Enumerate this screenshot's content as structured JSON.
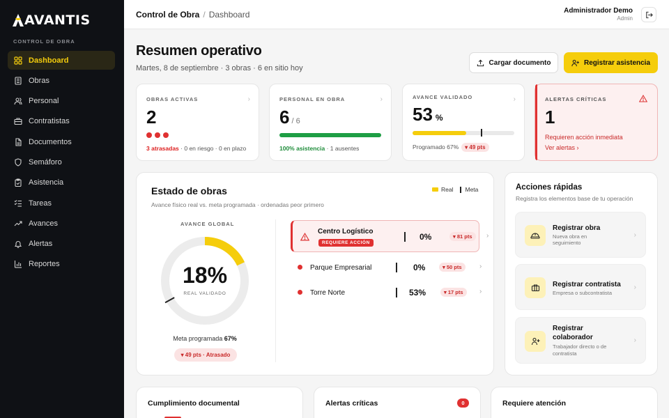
{
  "brand": {
    "name": "AVANTIS",
    "accent": "#f5cd0c"
  },
  "sidebar": {
    "section": "CONTROL DE OBRA",
    "items": [
      {
        "label": "Dashboard",
        "icon": "grid-icon",
        "active": true
      },
      {
        "label": "Obras",
        "icon": "building-icon"
      },
      {
        "label": "Personal",
        "icon": "users-icon"
      },
      {
        "label": "Contratistas",
        "icon": "briefcase-icon"
      },
      {
        "label": "Documentos",
        "icon": "file-icon"
      },
      {
        "label": "Semáforo",
        "icon": "shield-icon"
      },
      {
        "label": "Asistencia",
        "icon": "clipboard-icon"
      },
      {
        "label": "Tareas",
        "icon": "list-check-icon"
      },
      {
        "label": "Avances",
        "icon": "trend-icon"
      },
      {
        "label": "Alertas",
        "icon": "bell-icon"
      },
      {
        "label": "Reportes",
        "icon": "bar-chart-icon"
      }
    ]
  },
  "topbar": {
    "section": "Control de Obra",
    "separator": "/",
    "page": "Dashboard",
    "user_name": "Administrador Demo",
    "user_role": "Admin"
  },
  "header": {
    "title": "Resumen operativo",
    "subtitle": "Martes, 8 de septiembre · 3 obras · 6 en sitio hoy",
    "upload_label": "Cargar documento",
    "register_label": "Registrar asistencia"
  },
  "stats": {
    "obras": {
      "label": "OBRAS ACTIVAS",
      "value": "2",
      "late": "3 atrasadas",
      "rest": " · 0 en riesgo · 0 en plazo"
    },
    "personal": {
      "label": "PERSONAL EN OBRA",
      "value": "6",
      "total": "/ 6",
      "progress": 1.0,
      "attendance": "100% asistencia",
      "absent": " · 1 ausentes"
    },
    "avance": {
      "label": "AVANCE VALIDADO",
      "value": "53",
      "unit": "%",
      "progress": 0.53,
      "target": 0.67,
      "programmed": "Programado 67%",
      "delta": "▾ 49 pts"
    },
    "alertas": {
      "label": "ALERTAS CRÍTICAS",
      "value": "1",
      "text": "Requieren acción inmediata",
      "link": "Ver alertas"
    }
  },
  "estado": {
    "title": "Estado de obras",
    "subtitle": "Avance físico real vs. meta programada · ordenadas peor primero",
    "legend_real": "Real",
    "legend_meta": "Meta",
    "gauge_label": "AVANCE GLOBAL",
    "gauge_value": "18%",
    "gauge_progress": 0.18,
    "gauge_target": 0.67,
    "gauge_sub": "REAL VALIDADO",
    "meta_prefix": "Meta programada ",
    "meta_value": "67%",
    "late_badge": "▾ 49 pts · Atrasado",
    "obras": [
      {
        "name": "Centro Logístico",
        "tag": "REQUIERE ACCIÓN",
        "pct": "0%",
        "badge": "▾ 81 pts"
      },
      {
        "name": "Parque Empresarial",
        "pct": "0%",
        "badge": "▾ 50 pts"
      },
      {
        "name": "Torre Norte",
        "pct": "53%",
        "badge": "▾ 17 pts"
      }
    ]
  },
  "acciones": {
    "title": "Acciones rápidas",
    "subtitle": "Registra los elementos base de tu operación",
    "items": [
      {
        "title": "Registrar obra",
        "sub1": "Nueva obra en",
        "sub2": "seguimiento",
        "icon": "helmet-icon"
      },
      {
        "title": "Registrar contratista",
        "sub1": "Empresa o subcontratista",
        "sub2": "",
        "icon": "briefcase-icon"
      },
      {
        "title1": "Registrar",
        "title2": "colaborador",
        "sub1": "Trabajador directo o de",
        "sub2": "contratista",
        "icon": "user-plus-icon"
      }
    ]
  },
  "bottom": {
    "cumplimiento": "Cumplimiento documental",
    "alertas": "Alertas críticas",
    "alertas_count": "0",
    "atencion": "Requiere atención"
  }
}
